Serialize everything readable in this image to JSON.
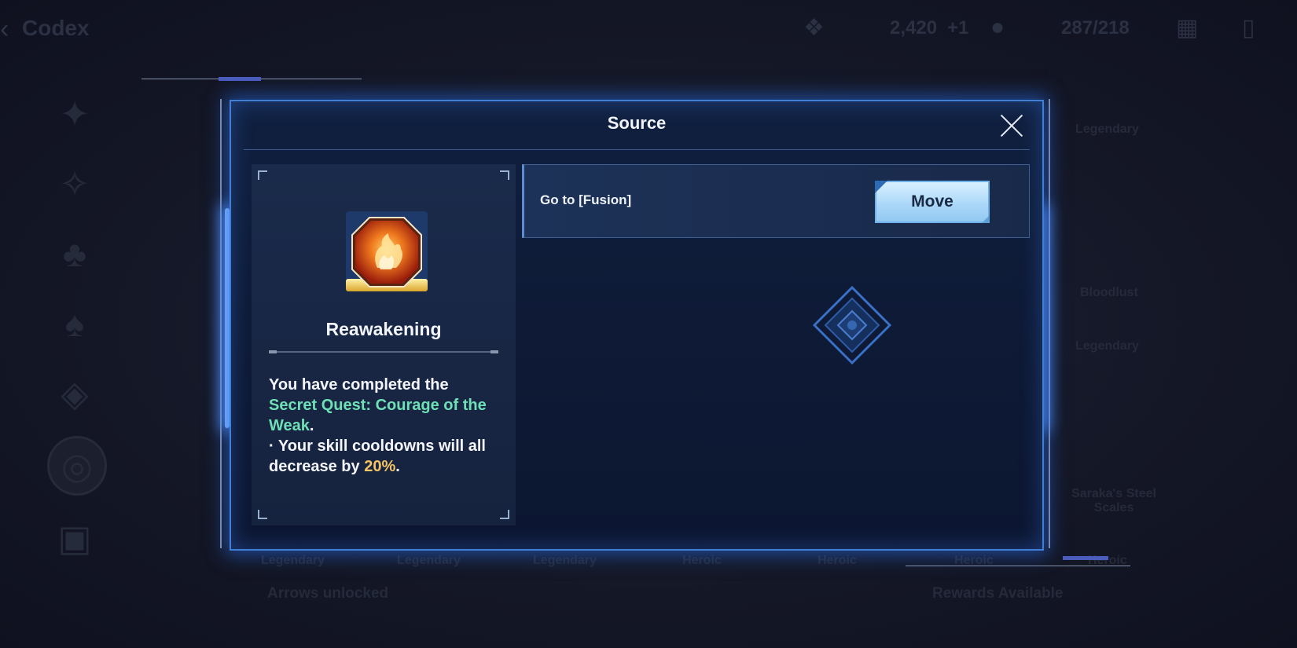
{
  "header": {
    "title": "Codex",
    "stat_a": "2,420",
    "stat_b": "+1",
    "stat_c": "287/218"
  },
  "background": {
    "card_labels": [
      "Legendary",
      "Bloodlust",
      "Legendary",
      "Saraka's Steel Scales"
    ],
    "tier_labels": [
      "Legendary",
      "Legendary",
      "Legendary",
      "Heroic",
      "Heroic",
      "Heroic",
      "Heroic"
    ],
    "bottom_left": "Arrows unlocked",
    "bottom_right": "Rewards Available"
  },
  "modal": {
    "title": "Source",
    "item": {
      "name": "Reawakening",
      "icon": "fire-fist-icon",
      "desc_line1": "You have completed the",
      "desc_quest": "Secret Quest: Courage of the Weak",
      "desc_period1": ".",
      "desc_line2": " · Your skill cooldowns will all decrease by ",
      "desc_percent": "20%",
      "desc_period2": "."
    },
    "source_row": {
      "label": "Go to [Fusion]",
      "button": "Move"
    }
  },
  "colors": {
    "modal_border": "#3f7fd6",
    "quest_text": "#6fe0b6",
    "percent_text": "#f2c463",
    "move_button": "#a8d6f8"
  }
}
